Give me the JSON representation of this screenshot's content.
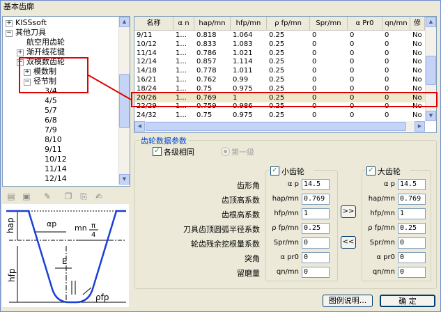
{
  "window": {
    "title": "基本齿廓"
  },
  "tree": {
    "items": [
      {
        "label": "KISSsoft",
        "expander": "+",
        "level": 0
      },
      {
        "label": "其他刀具",
        "expander": "−",
        "level": 0
      },
      {
        "label": "航空用齿轮",
        "expander": "",
        "level": 1
      },
      {
        "label": "渐开线花键",
        "expander": "+",
        "level": 1
      },
      {
        "label": "双模数齿轮",
        "expander": "−",
        "level": 1
      },
      {
        "label": "模数制",
        "expander": "+",
        "level": 2
      },
      {
        "label": "径节制",
        "expander": "−",
        "level": 2
      },
      {
        "label": "3/4",
        "expander": "",
        "level": 3
      },
      {
        "label": "4/5",
        "expander": "",
        "level": 3
      },
      {
        "label": "5/7",
        "expander": "",
        "level": 3
      },
      {
        "label": "6/8",
        "expander": "",
        "level": 3
      },
      {
        "label": "7/9",
        "expander": "",
        "level": 3
      },
      {
        "label": "8/10",
        "expander": "",
        "level": 3
      },
      {
        "label": "9/11",
        "expander": "",
        "level": 3
      },
      {
        "label": "10/12",
        "expander": "",
        "level": 3
      },
      {
        "label": "11/14",
        "expander": "",
        "level": 3
      },
      {
        "label": "12/14",
        "expander": "",
        "level": 3
      }
    ]
  },
  "table": {
    "columns": [
      "名称",
      "α n",
      "hap/mn",
      "hfp/mn",
      "ρ fp/mn",
      "Spr/mn",
      "α Pr0",
      "qn/mn",
      "修"
    ],
    "rows": [
      [
        "9/11",
        "1...",
        "0.818",
        "1.064",
        "0.25",
        "0",
        "0",
        "0",
        "No"
      ],
      [
        "10/12",
        "1...",
        "0.833",
        "1.083",
        "0.25",
        "0",
        "0",
        "0",
        "No"
      ],
      [
        "11/14",
        "1...",
        "0.786",
        "1.021",
        "0.25",
        "0",
        "0",
        "0",
        "No"
      ],
      [
        "12/14",
        "1...",
        "0.857",
        "1.114",
        "0.25",
        "0",
        "0",
        "0",
        "No"
      ],
      [
        "14/18",
        "1...",
        "0.778",
        "1.011",
        "0.25",
        "0",
        "0",
        "0",
        "No"
      ],
      [
        "16/21",
        "1...",
        "0.762",
        "0.99",
        "0.25",
        "0",
        "0",
        "0",
        "No"
      ],
      [
        "18/24",
        "1...",
        "0.75",
        "0.975",
        "0.25",
        "0",
        "0",
        "0",
        "No"
      ],
      [
        "20/26",
        "1...",
        "0.769",
        "1",
        "0.25",
        "0",
        "0",
        "0",
        "No"
      ],
      [
        "22/29",
        "1...",
        "0.759",
        "0.986",
        "0.25",
        "0",
        "0",
        "0",
        "No"
      ],
      [
        "24/32",
        "1...",
        "0.75",
        "0.975",
        "0.25",
        "0",
        "0",
        "0",
        "No"
      ]
    ]
  },
  "params": {
    "group_title": "齿轮数据参数",
    "all_same_label": "各级相同",
    "first_stage_label": "第一级",
    "pinion_label": "小齿轮",
    "gear_label": "大齿轮",
    "rows": [
      {
        "label": "齿形角",
        "symbol": "α p",
        "pinion": "14.5",
        "gear": "14.5"
      },
      {
        "label": "齿顶高系数",
        "symbol": "hap/mn",
        "pinion": "0.769",
        "gear": "0.769"
      },
      {
        "label": "齿根高系数",
        "symbol": "hfp/mn",
        "pinion": "1",
        "gear": "1"
      },
      {
        "label": "刀具齿顶圆弧半径系数",
        "symbol": "ρ fp/mn",
        "pinion": "0.25",
        "gear": "0.25"
      },
      {
        "label": "轮齿残余挖根量系数",
        "symbol": "Spr/mn",
        "pinion": "0",
        "gear": "0"
      },
      {
        "label": "突角",
        "symbol": "α pr0",
        "pinion": "0",
        "gear": "0"
      },
      {
        "label": "留磨量",
        "symbol": "qn/mn",
        "pinion": "0",
        "gear": "0"
      }
    ],
    "copy_right_label": ">>",
    "copy_left_label": "<<"
  },
  "diagram": {
    "alpha_label": "αp",
    "mn_label": "mn",
    "pi_label": "π",
    "quarter_label": "4",
    "hap_label": "hap",
    "hfp_label": "hfp",
    "e_label": "E",
    "rho_label": "ρfp"
  },
  "buttons": {
    "legend": "图例说明...",
    "ok": "确  定"
  }
}
